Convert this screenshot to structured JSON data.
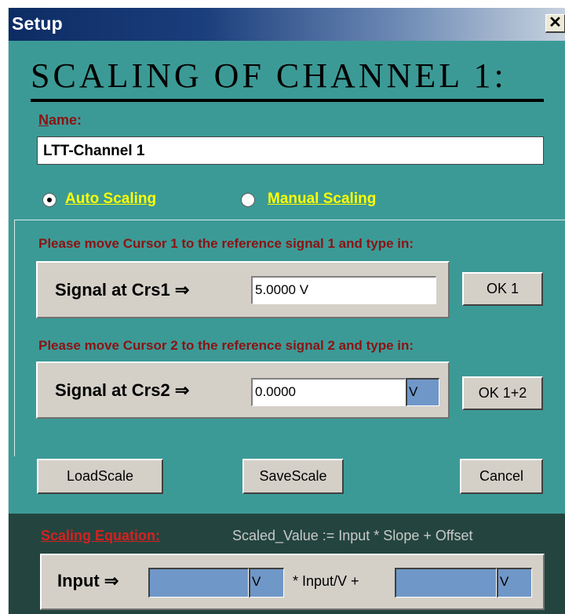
{
  "window": {
    "title": "Setup",
    "close_glyph": "✕"
  },
  "heading": "Scaling of Channel 1:",
  "name": {
    "label_accel": "N",
    "label_rest": "ame:",
    "value": "LTT-Channel 1"
  },
  "scaling_mode": {
    "auto_label": "Auto Scaling",
    "manual_label": "Manual Scaling",
    "selected": "auto"
  },
  "cursor1": {
    "instruction": "Please move Cursor 1 to the reference signal 1 and type in:",
    "label": "Signal at Crs1 ⇒",
    "value": "5.0000 V",
    "button": "OK 1"
  },
  "cursor2": {
    "instruction": "Please move Cursor 2 to the reference signal 2 and type in:",
    "label": "Signal at Crs2 ⇒",
    "value": "0.0000",
    "unit": "V",
    "button": "OK 1+2"
  },
  "buttons": {
    "load": "LoadScale",
    "save": "SaveScale",
    "cancel": "Cancel"
  },
  "equation": {
    "label": "Scaling Equation:",
    "text": "Scaled_Value := Input * Slope + Offset",
    "input_label": "Input ⇒",
    "slope_value": "",
    "slope_unit": "V",
    "middle_text": "* Input/V +",
    "offset_value": "",
    "offset_unit": "V"
  },
  "colors": {
    "window_bg": "#3c9a96",
    "bottom_bg": "#24453f",
    "label_red": "#8b1313",
    "link_yellow": "#ffff00",
    "field_blue": "#6f97c8"
  }
}
